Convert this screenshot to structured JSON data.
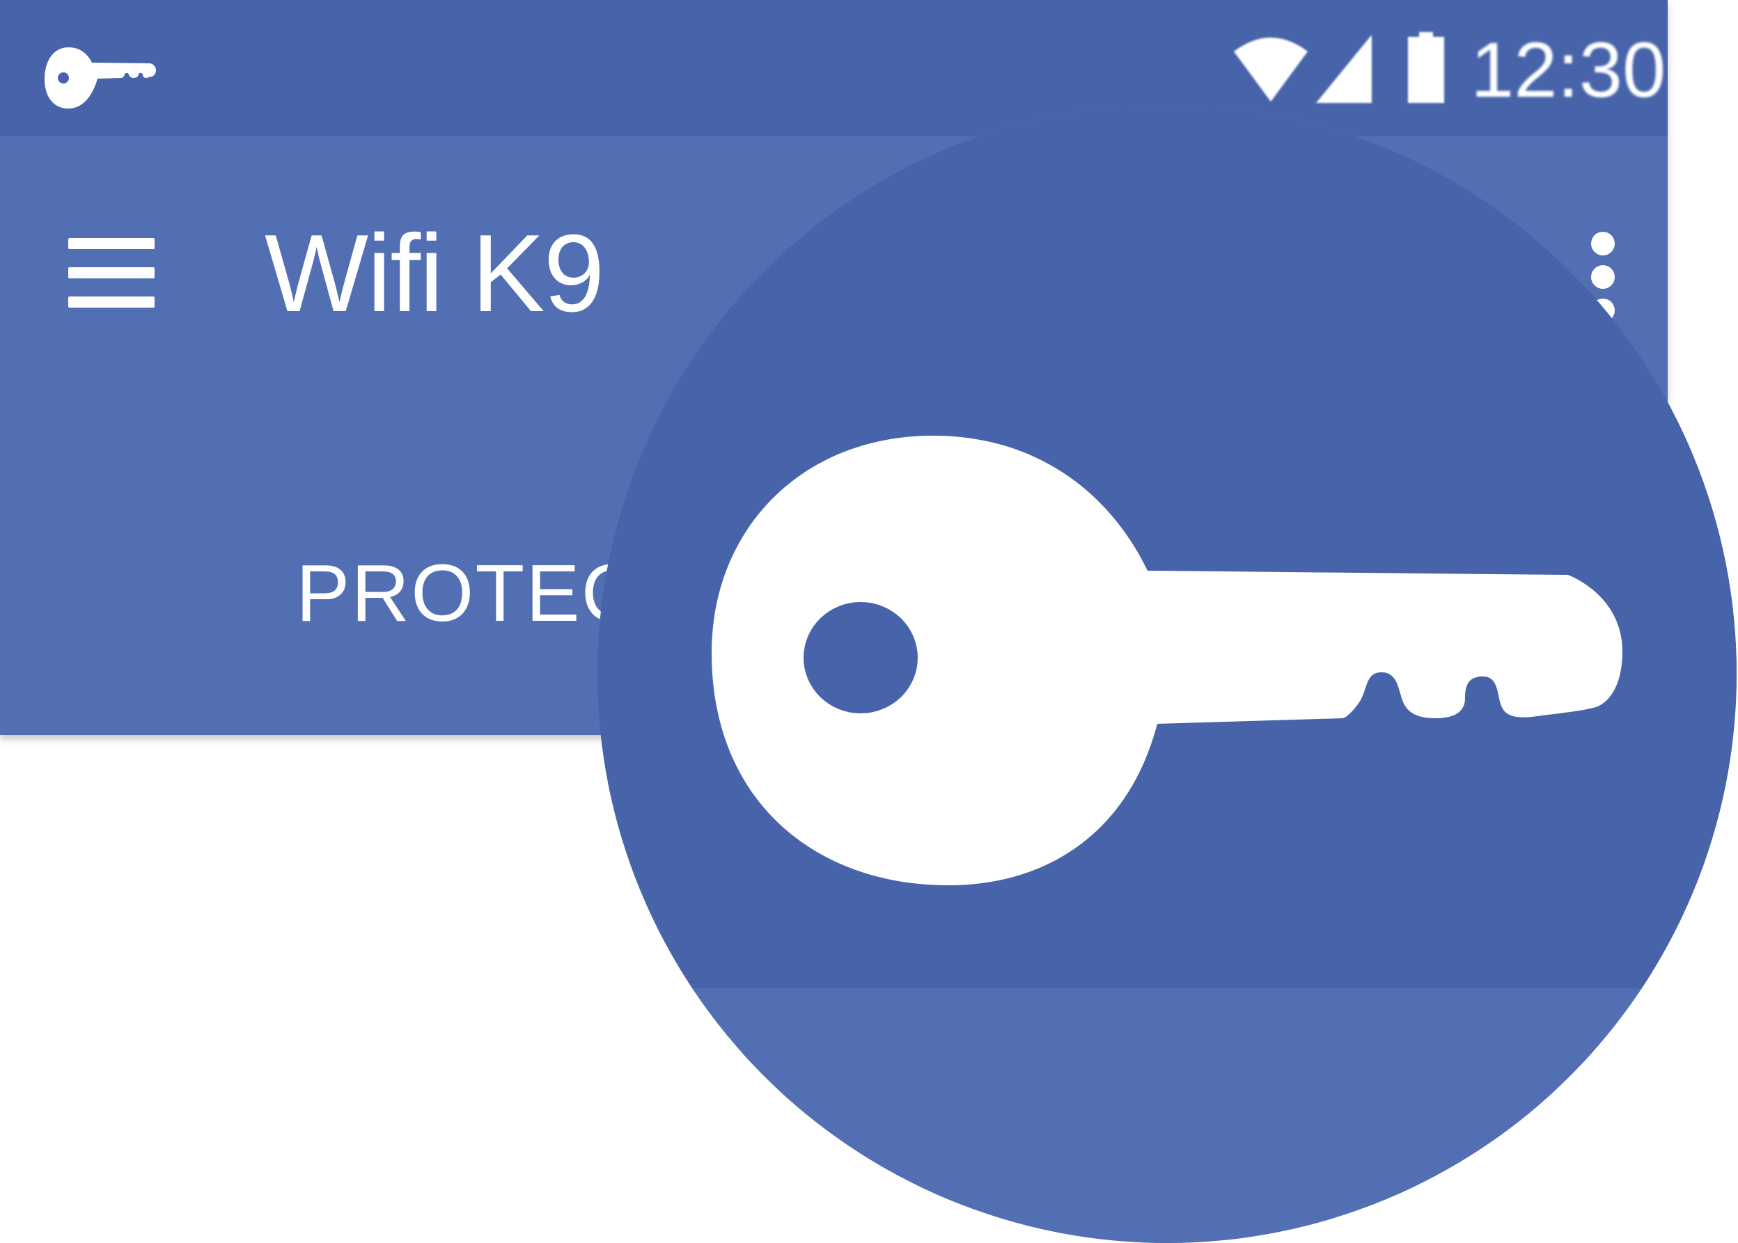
{
  "status_bar": {
    "time": "12:30",
    "app_icon": "key-icon",
    "icons": [
      "wifi-icon",
      "signal-icon",
      "battery-icon"
    ]
  },
  "app_bar": {
    "title": "Wifi K9",
    "menu_icon": "hamburger-menu-icon",
    "overflow_icon": "more-vertical-icon"
  },
  "tabs": [
    {
      "label": "PROTECT"
    }
  ],
  "magnifier": {
    "icon": "key-icon"
  },
  "colors": {
    "status_bar": "#4764aa",
    "toolbar": "#516fb2",
    "lens_dark": "#4764aa",
    "lens_light": "#516fb2",
    "foreground": "#ffffff"
  }
}
